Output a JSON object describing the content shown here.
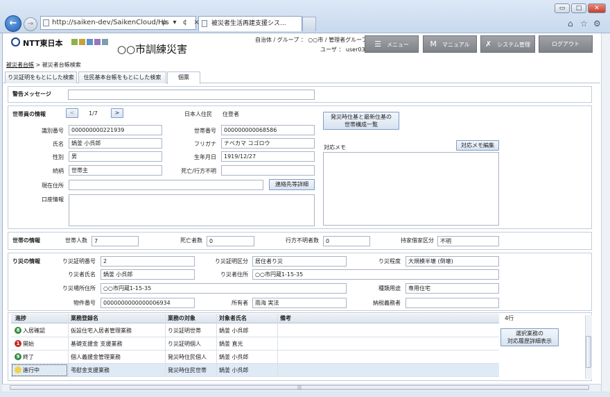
{
  "browser": {
    "url": "http://saiken-dev/SaikenCloud/His",
    "addr_tools": "ρ ▾ ¢ ×",
    "tab_title": "被災者生活再建支援シス...",
    "win_min": "▭",
    "win_max": "□",
    "win_close": "✕",
    "home_icon": "⌂",
    "star_icon": "☆",
    "gear_icon": "⚙"
  },
  "header": {
    "company": "NTT東日本",
    "city_title": "○○市訓練災害",
    "group_line": "自治体 / グループ ： ○○市 / 管理者グループ",
    "user_line": "ユーザ ： user03",
    "menu_label": "メニュー",
    "manual_label": "マニュアル",
    "manual_icon": "M",
    "system_label": "システム管理",
    "logout_label": "ログアウト"
  },
  "breadcrumb": {
    "link": "被災者台帳",
    "current": " > 被災者台帳検索"
  },
  "page_tabs": [
    "り災証明をもとにした検索",
    "住民基本台帳をもとにした検索",
    "個票"
  ],
  "warning": {
    "label": "警告メッセージ",
    "value": ""
  },
  "household_member": {
    "heading": "世帯員の情報",
    "prev": "<",
    "pager": "1/7",
    "next": ">",
    "resident_label": "日本人住民",
    "resident_value": "住登者",
    "composition_button": "発災時住基と最新住基の\n世帯構成一覧",
    "id_label": "識別番号",
    "id_value": "000000000221939",
    "household_no_label": "世帯番号",
    "household_no_value": "000000000068586",
    "name_label": "氏名",
    "name_value": "鍋釜 小呉郎",
    "kana_label": "フリガナ",
    "kana_value": "ナベカマ コゴロウ",
    "sex_label": "性別",
    "sex_value": "男",
    "birth_label": "生年月日",
    "birth_value": "1919/12/27",
    "relation_label": "続柄",
    "relation_value": "世帯主",
    "death_label": "死亡/行方不明",
    "death_value": "",
    "address_label": "現在住所",
    "address_value": "",
    "contact_button": "連絡先等詳細",
    "account_label": "口座情報",
    "memo_label": "対応メモ",
    "memo_button": "対応メモ編集"
  },
  "household": {
    "heading": "世帯の情報",
    "count_label": "世帯人数",
    "count_value": "7",
    "dead_label": "死亡者数",
    "dead_value": "0",
    "missing_label": "行方不明者数",
    "missing_value": "0",
    "owner_label": "持家借家区分",
    "owner_value": "不明"
  },
  "disaster": {
    "heading": "り災の情報",
    "cert_no_label": "り災証明番号",
    "cert_no_value": "2",
    "cert_type_label": "り災証明区分",
    "cert_type_value": "居住者り災",
    "degree_label": "り災程度",
    "degree_value": "大規模半壊 (倒壊)",
    "victim_name_label": "り災者氏名",
    "victim_name_value": "鍋釜 小呉郎",
    "victim_addr_label": "り災者住所",
    "victim_addr_value": "○○市円蔵1-15-35",
    "place_label": "り災場所住所",
    "place_value": "○○市円蔵1-15-35",
    "use_label": "種類用途",
    "use_value": "専用住宅",
    "property_label": "物件番号",
    "property_value": "0000000000000006934",
    "owner_label": "所有者",
    "owner_value": "雨海 実法",
    "tax_label": "納税義務者",
    "tax_value": ""
  },
  "progress_table": {
    "columns": [
      "進捗",
      "業務登録名",
      "業務の対象",
      "対象者氏名",
      "備考"
    ],
    "row_count": "4行",
    "history_button": "選択業務の\n対応履歴詳細表示",
    "rows": [
      {
        "badge": "8",
        "badge_color": "#2e8b3a",
        "status": "入居確認",
        "business": "仮設住宅入居者管理業務",
        "target": "り災証明世帯",
        "person": "鍋釜 小呉郎",
        "note": ""
      },
      {
        "badge": "1",
        "badge_color": "#c62828",
        "status": "開始",
        "business": "基礎支援金 支援業務",
        "target": "り災証明個人",
        "person": "鍋釜 直光",
        "note": ""
      },
      {
        "badge": "9",
        "badge_color": "#2e8b3a",
        "status": "終了",
        "business": "個人義援金管理業務",
        "target": "発災時住民個人",
        "person": "鍋釜 小呉郎",
        "note": ""
      },
      {
        "badge": "",
        "badge_color": "#f2d24a",
        "status": "進行中",
        "business": "弔慰金支援業務",
        "target": "発災時住民世帯",
        "person": "鍋釜 小呉郎",
        "note": ""
      }
    ]
  },
  "scroll_arrow": "|||"
}
